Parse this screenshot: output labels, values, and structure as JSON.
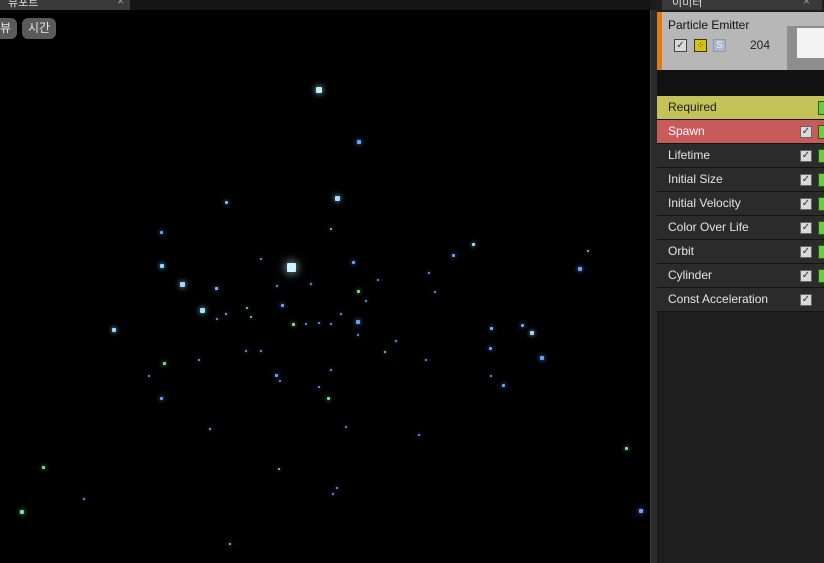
{
  "viewport": {
    "tab_label": "뷰포트",
    "buttons": [
      "뷰",
      "시간"
    ],
    "particles": []
  },
  "panel": {
    "tab_label": "이미터",
    "emitter": {
      "name": "Particle Emitter",
      "count": "204",
      "solo_label": "S"
    },
    "modules": [
      {
        "label": "Required",
        "kind": "required"
      },
      {
        "label": "Spawn",
        "kind": "spawn"
      },
      {
        "label": "Lifetime",
        "kind": "normal"
      },
      {
        "label": "Initial Size",
        "kind": "normal"
      },
      {
        "label": "Initial Velocity",
        "kind": "normal"
      },
      {
        "label": "Color Over Life",
        "kind": "normal"
      },
      {
        "label": "Orbit",
        "kind": "normal"
      },
      {
        "label": "Cylinder",
        "kind": "normal"
      },
      {
        "label": "Const Acceleration",
        "kind": "normal"
      }
    ]
  },
  "colors": {
    "accent_orange": "#e07b12",
    "required_yellow": "#c3c35a",
    "spawn_red": "#c85a5a",
    "particle_blue": "#6aa0ff",
    "particle_cyan": "#7fe0ff",
    "particle_green": "#7fe08a"
  }
}
